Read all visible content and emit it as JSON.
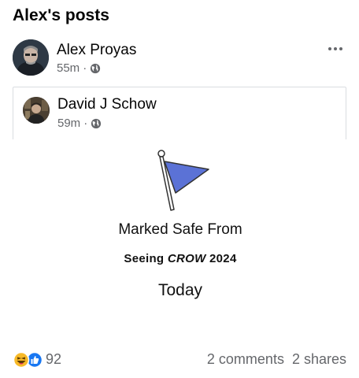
{
  "page": {
    "title": "Alex's posts"
  },
  "post": {
    "author": "Alex Proyas",
    "time": "55m",
    "separator": "·",
    "privacy_icon": "globe-icon",
    "more_icon": "more-dots-icon"
  },
  "shared_post": {
    "author": "David J Schow",
    "time": "59m",
    "separator": "·",
    "privacy_icon": "globe-icon",
    "image": {
      "flag_icon": "flag-icon",
      "line1": "Marked Safe From",
      "line2_prefix": "Seeing ",
      "line2_emph": "CROW",
      "line2_suffix": " 2024",
      "line3": "Today"
    }
  },
  "footer": {
    "reaction_icons": [
      "haha-icon",
      "like-icon"
    ],
    "reaction_count": "92",
    "comments": "2 comments",
    "shares": "2 shares"
  },
  "colors": {
    "flag_blue": "#5b72d6",
    "like_blue": "#1877f2",
    "haha_yellow": "#f7b928",
    "secondary_text": "#65676b"
  }
}
